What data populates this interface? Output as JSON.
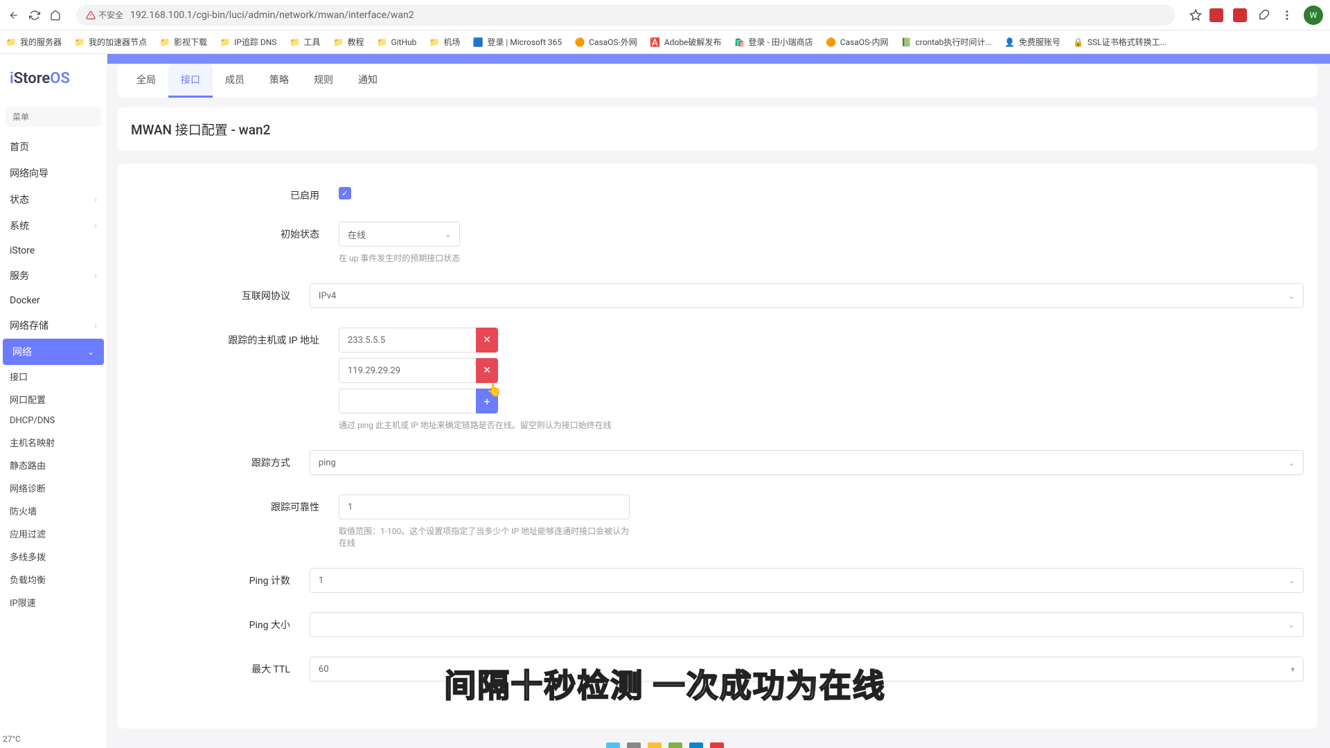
{
  "browser": {
    "security_label": "不安全",
    "url": "192.168.100.1/cgi-bin/luci/admin/network/mwan/interface/wan2"
  },
  "bookmarks": [
    "我的服务器",
    "我的加速器节点",
    "影视下载",
    "IP追踪 DNS",
    "工具",
    "教程",
    "GitHub",
    "机场",
    "登录 | Microsoft 365",
    "CasaOS-外网",
    "Adobe破解发布",
    "登录 - 田小瑞商店",
    "CasaOS-内网",
    "crontab执行时间计...",
    "免费服账号",
    "SSL证书格式转换工..."
  ],
  "logo": "iStoreOS",
  "search_menu_placeholder": "菜单",
  "sidebar": {
    "top": [
      "首页",
      "网络向导"
    ],
    "exp": [
      "状态",
      "系统"
    ],
    "istore": "iStore",
    "exp2": [
      "服务",
      "Docker",
      "网络存储"
    ],
    "network": "网络",
    "sub": [
      "接口",
      "网口配置",
      "DHCP/DNS",
      "主机名映射",
      "静态路由",
      "网络诊断",
      "防火墙",
      "应用过滤",
      "多线多拨",
      "负载均衡",
      "IP限速"
    ]
  },
  "tabs": [
    "全局",
    "接口",
    "成员",
    "策略",
    "规则",
    "通知"
  ],
  "page_title": "MWAN 接口配置 - wan2",
  "form": {
    "enabled_label": "已启用",
    "initial_state_label": "初始状态",
    "initial_state_value": "在线",
    "initial_state_hint": "在 up 事件发生时的预期接口状态",
    "protocol_label": "互联网协议",
    "protocol_value": "IPv4",
    "track_label": "跟踪的主机或 IP 地址",
    "track_ips": [
      "233.5.5.5",
      "119.29.29.29"
    ],
    "track_hint": "通过 ping 此主机或 IP 地址来确定链路是否在线。留空则认为接口始终在线",
    "track_method_label": "跟踪方式",
    "track_method_value": "ping",
    "track_reliability_label": "跟踪可靠性",
    "track_reliability_value": "1",
    "track_reliability_hint": "取值范围：1-100。这个设置项指定了当多少个 IP 地址能够连通时接口会被认为在线",
    "ping_count_label": "Ping 计数",
    "ping_count_value": "1",
    "ping_size_label": "Ping 大小",
    "max_ttl_label": "最大 TTL",
    "max_ttl_value": "60"
  },
  "caption": "间隔十秒检测 一次成功为在线",
  "temperature": "27°C"
}
